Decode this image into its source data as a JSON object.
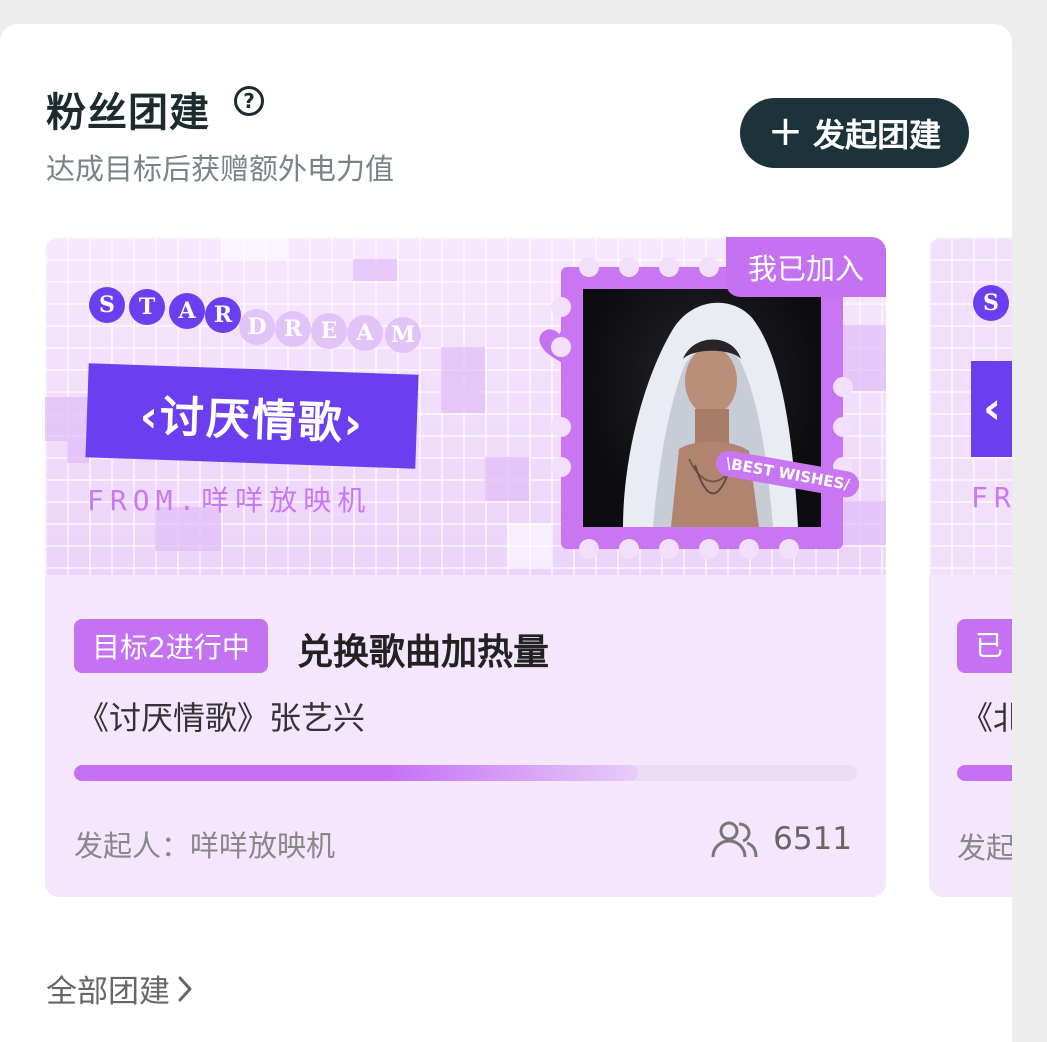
{
  "header": {
    "title": "粉丝团建",
    "help_icon": "?",
    "subtitle": "达成目标后获赠额外电力值",
    "launch_button": {
      "plus": "+",
      "label": "发起团建"
    }
  },
  "card": {
    "banner": {
      "star_letters": [
        "S",
        "T",
        "A",
        "R"
      ],
      "dream_letters": [
        "D",
        "R",
        "E",
        "A",
        "M"
      ],
      "song_title": "‹讨厌情歌›",
      "from_text": "FROM.咩咩放映机",
      "best_wishes": "\\BEST WISHES/"
    },
    "joined_tag": "我已加入",
    "status_badge": "目标2进行中",
    "goal": "兑换歌曲加热量",
    "song": "《讨厌情歌》张艺兴",
    "progress": 0.72,
    "initiator": "发起人：咩咩放映机",
    "participant_count": "6511"
  },
  "card2": {
    "s_letter": "S",
    "box_char": "‹",
    "from_text": "FR",
    "status_badge": "已",
    "song": "《北",
    "initiator": "发起"
  },
  "footer": {
    "all_link": "全部团建"
  },
  "colors": {
    "accent_purple": "#c471f2",
    "deep_purple": "#6b3ff0",
    "button_dark": "#1c3339",
    "card_bg": "#f4e6fd"
  }
}
